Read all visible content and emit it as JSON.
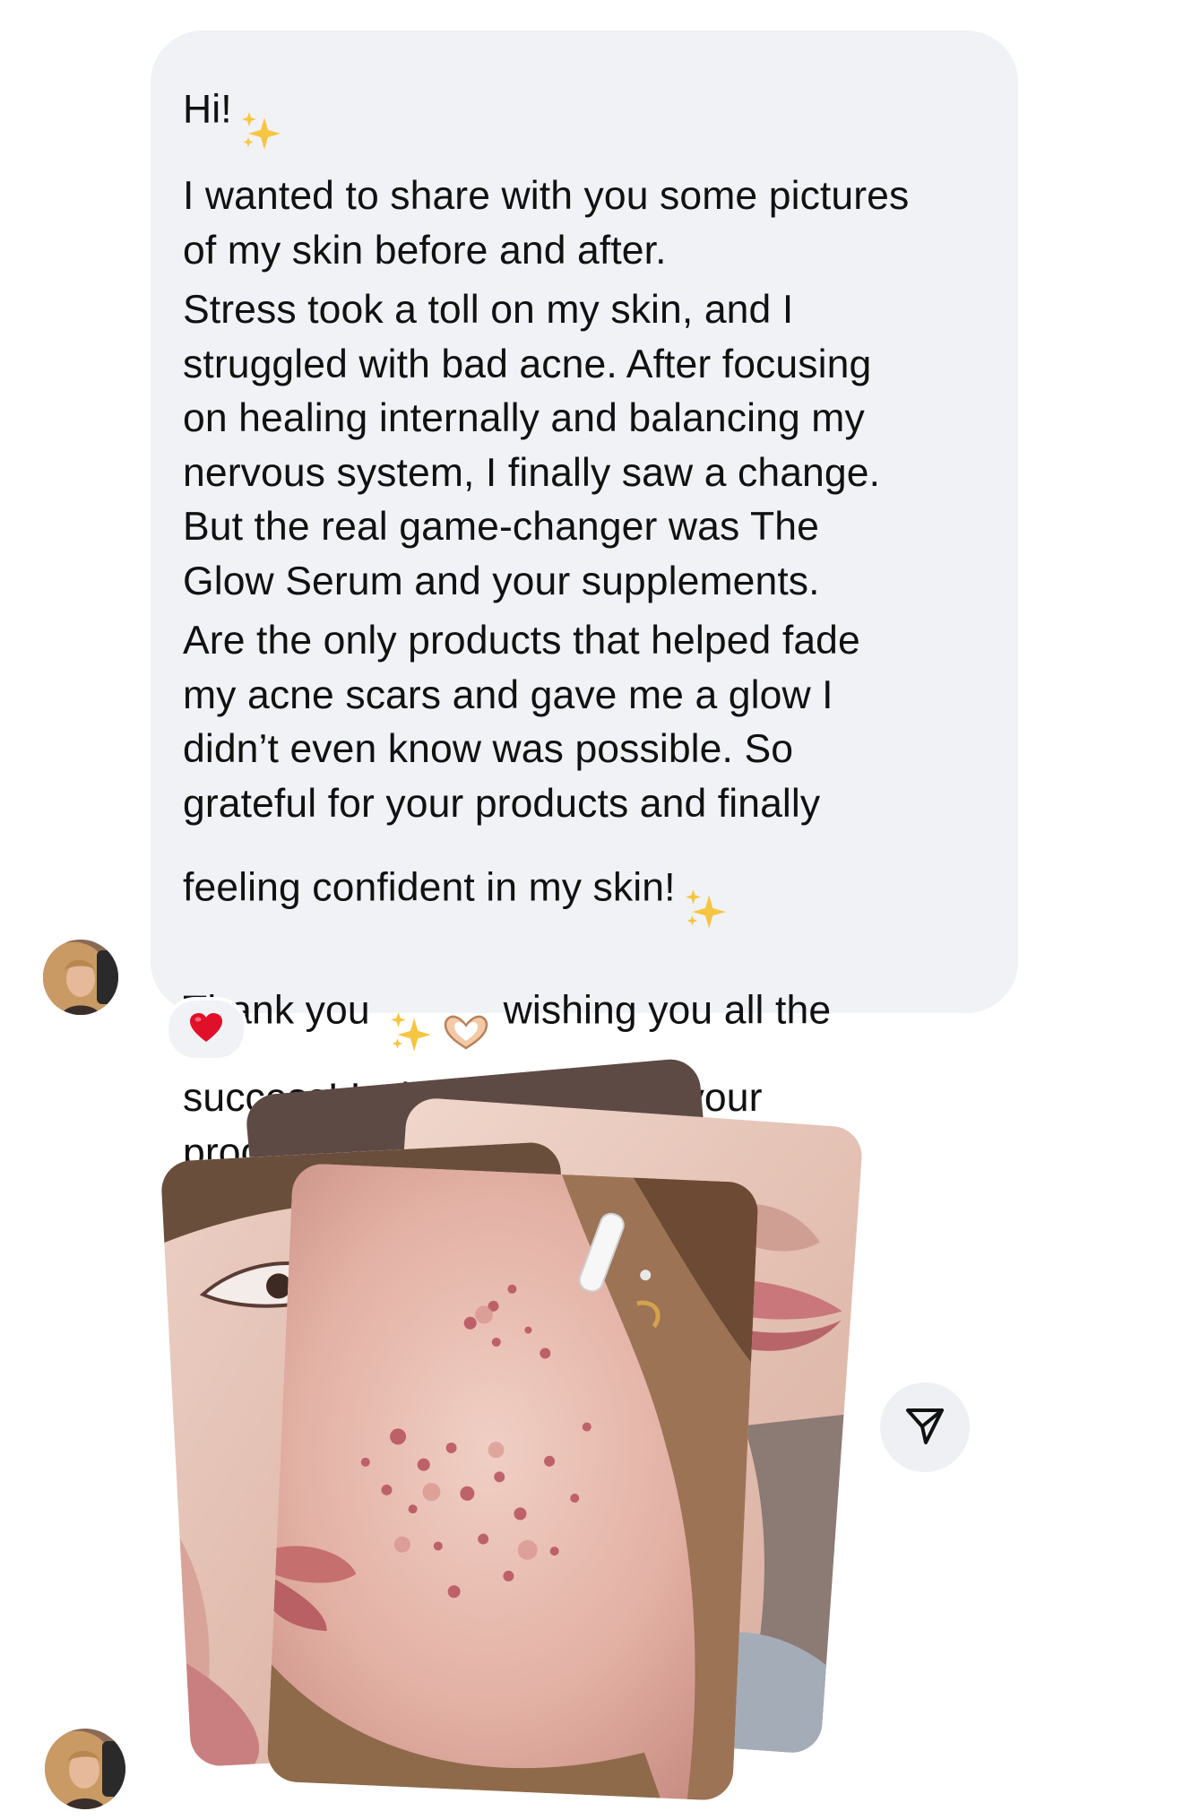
{
  "message": {
    "greeting": "Hi!",
    "paragraph_1": "I wanted to share with you some pictures\nof my skin before and after.",
    "paragraph_2": "Stress took a toll on my skin, and I\nstruggled with bad acne. After focusing\non healing internally and balancing my\nnervous system, I finally saw a change.\nBut the real game-changer was The\nGlow Serum and your supplements.",
    "paragraph_3": "Are the only products that helped fade\nmy acne scars and gave me a glow I\ndidn’t even know was possible. So\ngrateful for your products and finally\nfeeling confident in my skin!",
    "thanks_start": "Thank you",
    "thanks_rest": "wishing you all the",
    "paragraph_4_tail": "success! I will definitely use your\nproducts over and over again!",
    "reaction": "❤️"
  },
  "icons": {
    "sparkles": "sparkles-icon",
    "heart_hands": "heart-hands-icon",
    "heart": "heart-icon",
    "share": "paper-plane-icon"
  },
  "colors": {
    "bubble_bg": "#f1f2f5",
    "text": "#111111",
    "heart": "#e0102a"
  }
}
